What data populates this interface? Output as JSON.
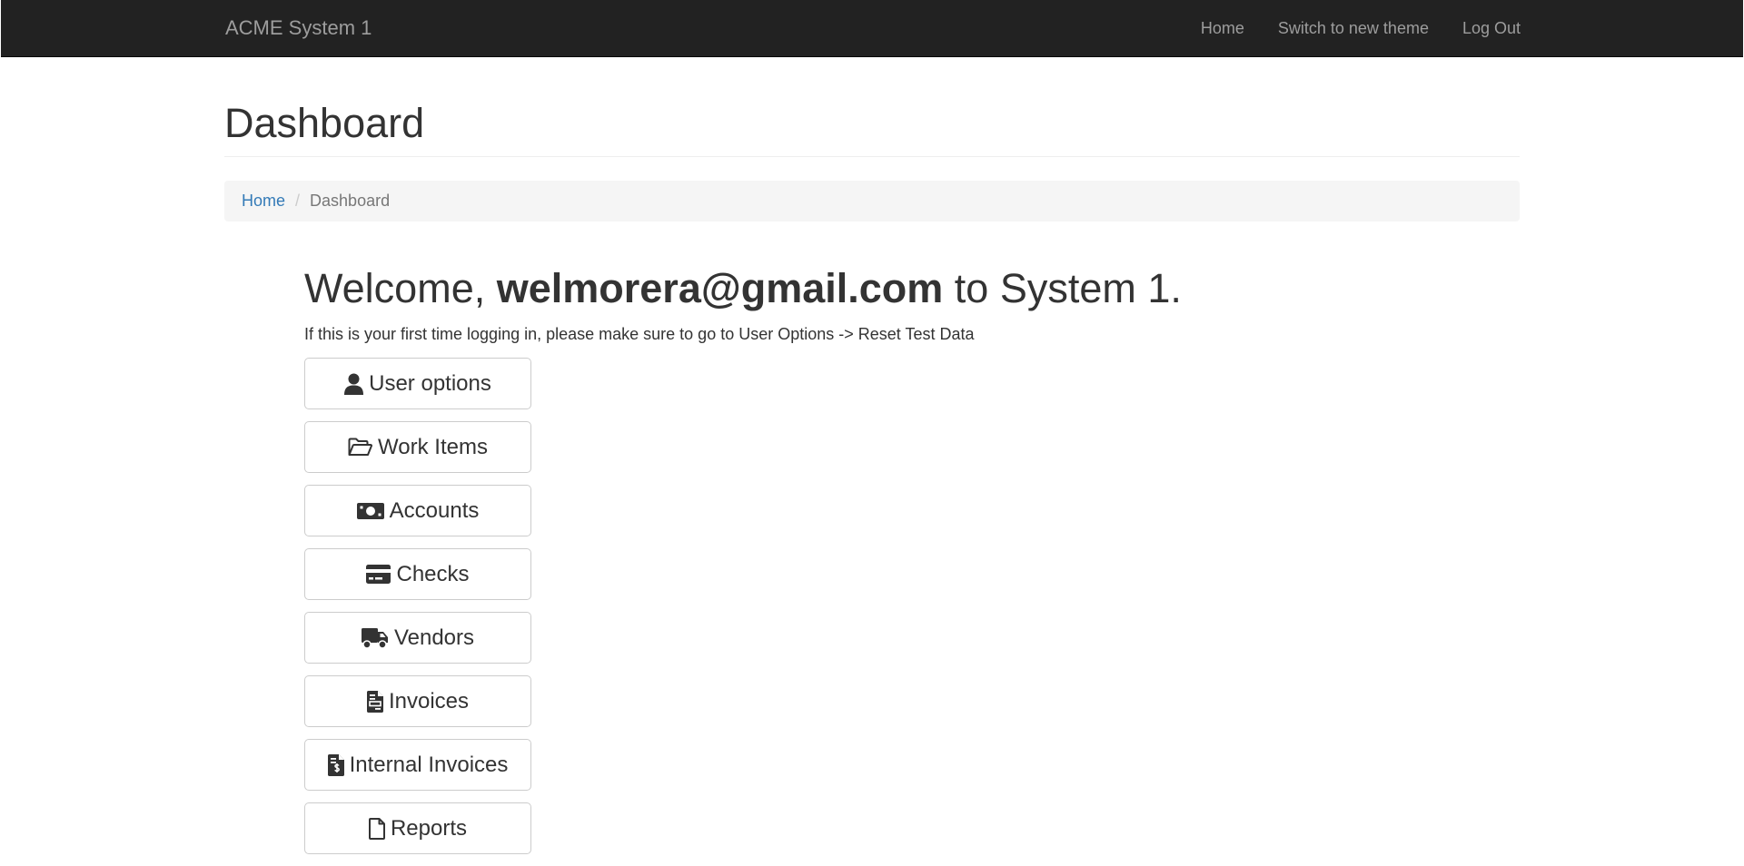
{
  "navbar": {
    "brand": "ACME System 1",
    "links": [
      "Home",
      "Switch to new theme",
      "Log Out"
    ]
  },
  "page": {
    "title": "Dashboard"
  },
  "breadcrumb": {
    "home": "Home",
    "separator": "/",
    "current": "Dashboard"
  },
  "welcome": {
    "prefix": "Welcome, ",
    "user": "welmorera@gmail.com",
    "suffix": " to System 1.",
    "info": "If this is your first time logging in, please make sure to go to User Options -> Reset Test Data"
  },
  "menu": {
    "items": [
      {
        "label": "User options",
        "icon": "user-icon"
      },
      {
        "label": "Work Items",
        "icon": "folder-open-icon"
      },
      {
        "label": "Accounts",
        "icon": "money-bill-icon"
      },
      {
        "label": "Checks",
        "icon": "credit-card-icon"
      },
      {
        "label": "Vendors",
        "icon": "truck-icon"
      },
      {
        "label": "Invoices",
        "icon": "file-invoice-icon"
      },
      {
        "label": "Internal Invoices",
        "icon": "file-invoice-dollar-icon"
      },
      {
        "label": "Reports",
        "icon": "file-icon"
      }
    ]
  },
  "colors": {
    "navbar_bg": "#222222",
    "navbar_text": "#9d9d9d",
    "link": "#337ab7",
    "breadcrumb_bg": "#f5f5f5",
    "text": "#333333"
  }
}
